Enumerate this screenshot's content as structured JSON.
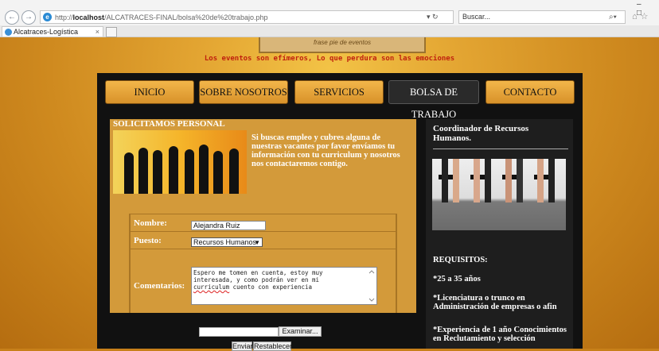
{
  "browser": {
    "url_prefix": "http://",
    "url_host": "localhost",
    "url_path": "/ALCATRACES-FINAL/bolsa%20de%20trabajo.php",
    "search_placeholder": "Buscar...",
    "tab_title": "Alcatraces-Logística",
    "tab_close": "×"
  },
  "site": {
    "banner_text": "frase pie de eventos",
    "tagline": "Los eventos son efímeros, Lo que perdura son las emociones"
  },
  "menu": {
    "items": [
      {
        "label": "INICIO"
      },
      {
        "label": "SOBRE NOSOTROS"
      },
      {
        "label": "SERVICIOS"
      },
      {
        "label": "BOLSA DE TRABAJO"
      },
      {
        "label": "CONTACTO"
      }
    ]
  },
  "main": {
    "section_title": "SOLICITAMOS PERSONAL",
    "intro": "Si buscas empleo y cubres alguna de nuestras vacantes por favor envíamos tu información con tu curriculum y nosotros nos contactaremos contigo."
  },
  "form": {
    "name_label": "Nombre:",
    "name_value": "Alejandra Ruiz",
    "position_label": "Puesto:",
    "position_value": "Recursos Humanos",
    "comments_label": "Comentarios:",
    "comments_line1": "Espero me tomen en cuenta, estoy muy",
    "comments_line2": "interesada, y como podrán ver en mi",
    "comments_word": "curriculum",
    "comments_line3_rest": " cuento con experiencia",
    "browse_label": "Examinar...",
    "submit_label": "Enviar",
    "reset_label": "Restablecer"
  },
  "sidebar": {
    "title": "Coordinador de Recursos Humanos.",
    "requirements_title": "REQUISITOS:",
    "requirements": [
      "*25 a 35 años",
      "*Licenciatura o trunco en Administración de empresas o afin",
      "*Experiencia de 1 año Conocimientos en Reclutamiento y selección"
    ]
  },
  "colors": {
    "accent": "#e3a532",
    "menu_button": "#f2b64a",
    "tagline": "#c0200e",
    "panel": "#d39a3a",
    "sidebar": "#1e1e1e"
  }
}
